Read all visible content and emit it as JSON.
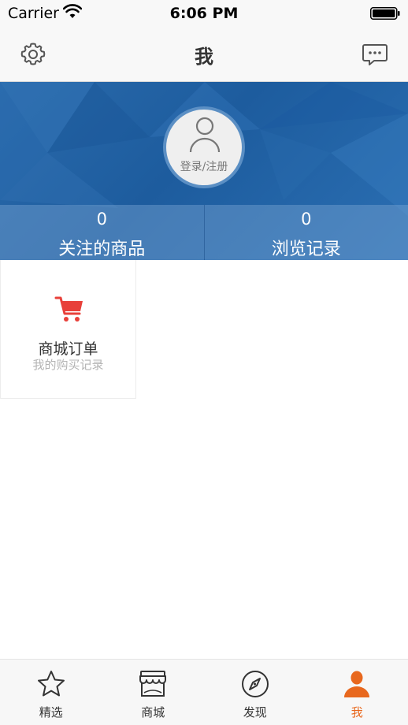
{
  "status_bar": {
    "carrier": "Carrier",
    "time": "6:06 PM"
  },
  "nav": {
    "title": "我",
    "left_icon": "gear-icon",
    "right_icon": "message-icon"
  },
  "profile": {
    "login_label": "登录/注册",
    "stats": [
      {
        "count": "0",
        "label": "关注的商品"
      },
      {
        "count": "0",
        "label": "浏览记录"
      }
    ]
  },
  "grid": [
    {
      "icon": "cart-icon",
      "title": "商城订单",
      "subtitle": "我的购买记录"
    }
  ],
  "tabs": [
    {
      "label": "精选",
      "icon": "star-icon",
      "active": false
    },
    {
      "label": "商城",
      "icon": "store-icon",
      "active": false
    },
    {
      "label": "发现",
      "icon": "compass-icon",
      "active": false
    },
    {
      "label": "我",
      "icon": "user-icon",
      "active": true
    }
  ],
  "colors": {
    "accent": "#e8681e",
    "banner": "#1d5c9e",
    "cart": "#e8403a"
  }
}
